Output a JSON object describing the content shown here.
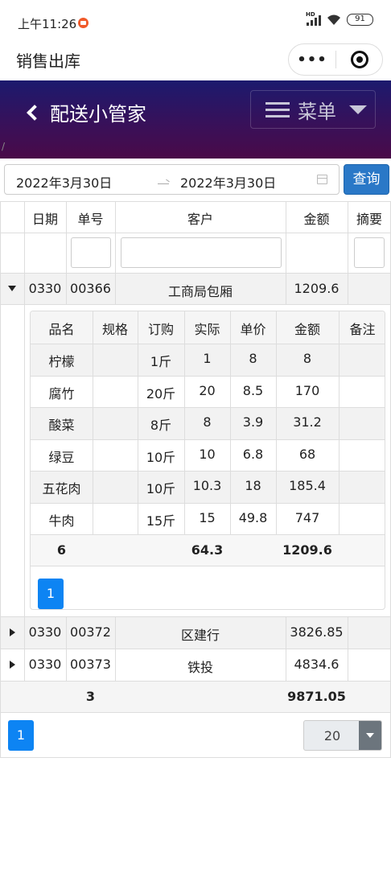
{
  "status": {
    "time": "上午11:26",
    "battery": "91"
  },
  "page_title": "销售出库",
  "header": {
    "app_name": "配送小管家",
    "menu_label": "菜单"
  },
  "slash": "/",
  "filter": {
    "start_date": "2022年3月30日",
    "end_date": "2022年3月30日",
    "query_label": "查询"
  },
  "columns": [
    "日期",
    "单号",
    "客户",
    "金额",
    "摘要"
  ],
  "orders": [
    {
      "date": "0330",
      "no": "00366",
      "customer": "工商局包厢",
      "amount": "1209.6",
      "expanded": true
    },
    {
      "date": "0330",
      "no": "00372",
      "customer": "区建行",
      "amount": "3826.85",
      "expanded": false
    },
    {
      "date": "0330",
      "no": "00373",
      "customer": "铁投",
      "amount": "4834.6",
      "expanded": false
    }
  ],
  "detail": {
    "columns": [
      "品名",
      "规格",
      "订购",
      "实际",
      "单价",
      "金额",
      "备注"
    ],
    "rows": [
      [
        "柠檬",
        "",
        "1斤",
        "1",
        "8",
        "8",
        ""
      ],
      [
        "腐竹",
        "",
        "20斤",
        "20",
        "8.5",
        "170",
        ""
      ],
      [
        "酸菜",
        "",
        "8斤",
        "8",
        "3.9",
        "31.2",
        ""
      ],
      [
        "绿豆",
        "",
        "10斤",
        "10",
        "6.8",
        "68",
        ""
      ],
      [
        "五花肉",
        "",
        "10斤",
        "10.3",
        "18",
        "185.4",
        ""
      ],
      [
        "牛肉",
        "",
        "15斤",
        "15",
        "49.8",
        "747",
        ""
      ]
    ],
    "footer": {
      "count": "6",
      "actual_total": "64.3",
      "amount_total": "1209.6"
    },
    "page": "1"
  },
  "summary": {
    "count": "3",
    "total": "9871.05"
  },
  "pagination": {
    "page": "1",
    "page_size": "20"
  }
}
